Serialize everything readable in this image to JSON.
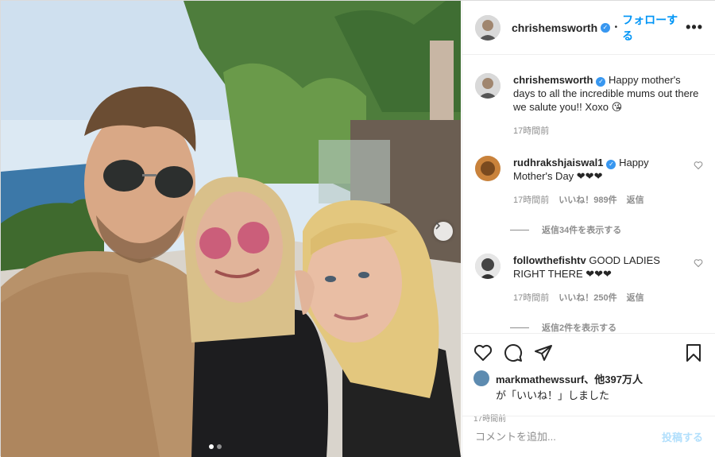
{
  "post": {
    "author": "chrishemsworth",
    "follow_sep": "•",
    "follow_label": "フォローする",
    "more_label": "•••"
  },
  "comments": [
    {
      "user": "chrishemsworth",
      "text": "Happy mother's days to all the incredible mums out there we salute you!! Xoxo 😘",
      "time": "17時間前"
    },
    {
      "user": "rudhrakshjaiswal1",
      "text": "Happy Mother's Day ❤❤❤",
      "time": "17時間前",
      "likes": "いいね！989件",
      "reply": "返信",
      "view_replies": "返信34件を表示する"
    },
    {
      "user": "followthefishtv",
      "text": "GOOD LADIES RIGHT THERE ❤❤❤",
      "time": "17時間前",
      "likes": "いいね！250件",
      "reply": "返信",
      "view_replies": "返信2件を表示する"
    }
  ],
  "likes": {
    "line1": "markmathewssurf、他397万人",
    "line2": "が「いいね！」しました"
  },
  "posted_time": "17時間前",
  "add_comment": {
    "placeholder": "コメントを追加...",
    "post_label": "投稿する"
  },
  "icons": [
    "heart-icon",
    "comment-icon",
    "share-icon",
    "bookmark-icon",
    "chevron-right-icon",
    "verified-icon",
    "more-icon"
  ],
  "colors": {
    "link": "#0095f6",
    "verified": "#3897f0",
    "meta": "#8e8e8e",
    "post_disabled": "#b2dffc"
  }
}
